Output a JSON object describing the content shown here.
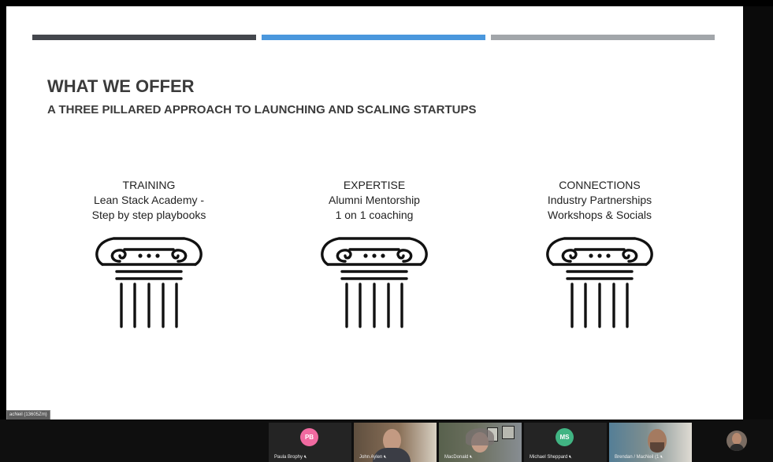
{
  "slide": {
    "title": "WHAT WE OFFER",
    "subtitle": "A THREE PILLARED APPROACH TO LAUNCHING AND SCALING STARTUPS",
    "pillars": [
      {
        "heading": "TRAINING",
        "line1": "Lean Stack Academy -",
        "line2": "Step by step playbooks",
        "icon": "greek-column-icon"
      },
      {
        "heading": "EXPERTISE",
        "line1": "Alumni Mentorship",
        "line2": "1 on 1 coaching",
        "icon": "greek-column-icon"
      },
      {
        "heading": "CONNECTIONS",
        "line1": "Industry Partnerships",
        "line2": "Workshops & Socials",
        "icon": "greek-column-icon"
      }
    ],
    "colors": {
      "bar_dark": "#44474d",
      "bar_blue": "#4a97dd",
      "bar_gray": "#a2a6aa",
      "text": "#3b3b3b"
    }
  },
  "overlay": {
    "speaker_tag": "acNeil (13605Zm)"
  },
  "participants": [
    {
      "name": "Paula Brophy",
      "initials": "PB",
      "avatar_color": "#f06aa0",
      "muted_icon": "mic-muted-icon"
    },
    {
      "name": "John Aylen",
      "video": true,
      "muted_icon": "mic-muted-icon"
    },
    {
      "name": "MacDonald",
      "video": true,
      "muted_icon": "mic-muted-icon"
    },
    {
      "name": "Michael Sheppard",
      "initials": "MS",
      "avatar_color": "#41b483",
      "muted_icon": "mic-muted-icon"
    },
    {
      "name": "Brendan / MacNeil (1",
      "video": true,
      "muted_icon": "mic-muted-icon"
    }
  ]
}
